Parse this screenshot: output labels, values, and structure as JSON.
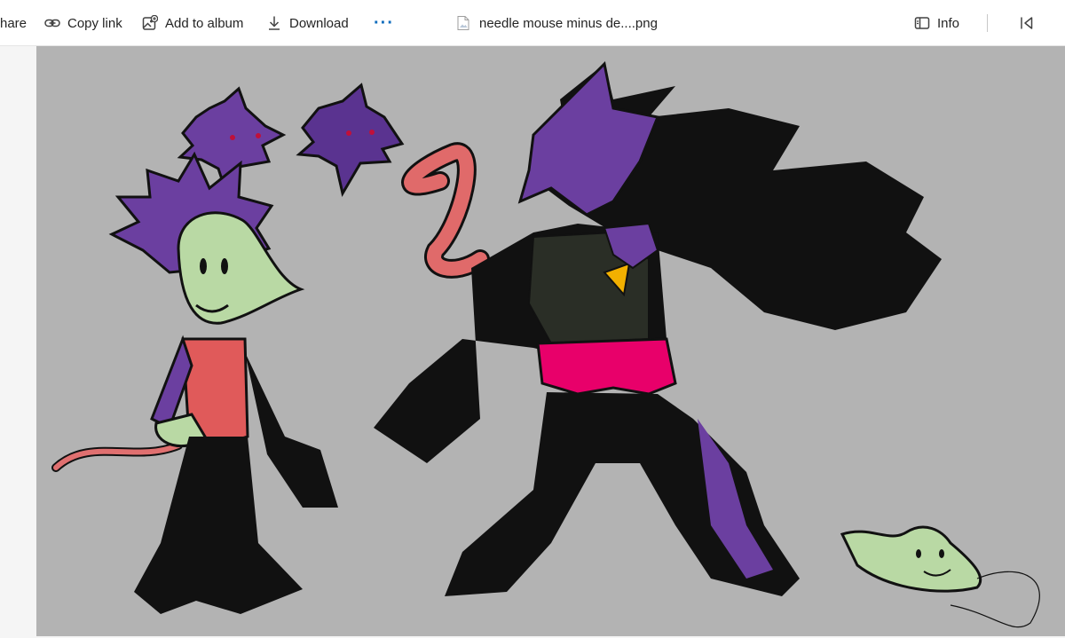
{
  "toolbar": {
    "share_label": "hare",
    "copy_link_label": "Copy link",
    "add_to_album_label": "Add to album",
    "download_label": "Download",
    "more_label": "···",
    "file_name": "needle mouse minus de....png",
    "info_label": "Info"
  },
  "icons": {
    "copy_link": "link-icon",
    "add_to_album": "album-add-icon",
    "download": "download-icon",
    "file": "image-file-icon",
    "info": "info-panel-icon",
    "collapse": "collapse-panel-icon"
  },
  "colors": {
    "toolbar_bg": "#ffffff",
    "accent": "#0f6cbd",
    "canvas_bg": "#b3b3b3",
    "purple": "#6b3fa0",
    "mint": "#b9d9a4",
    "pink": "#e8006a",
    "coral": "#e05a5a"
  }
}
